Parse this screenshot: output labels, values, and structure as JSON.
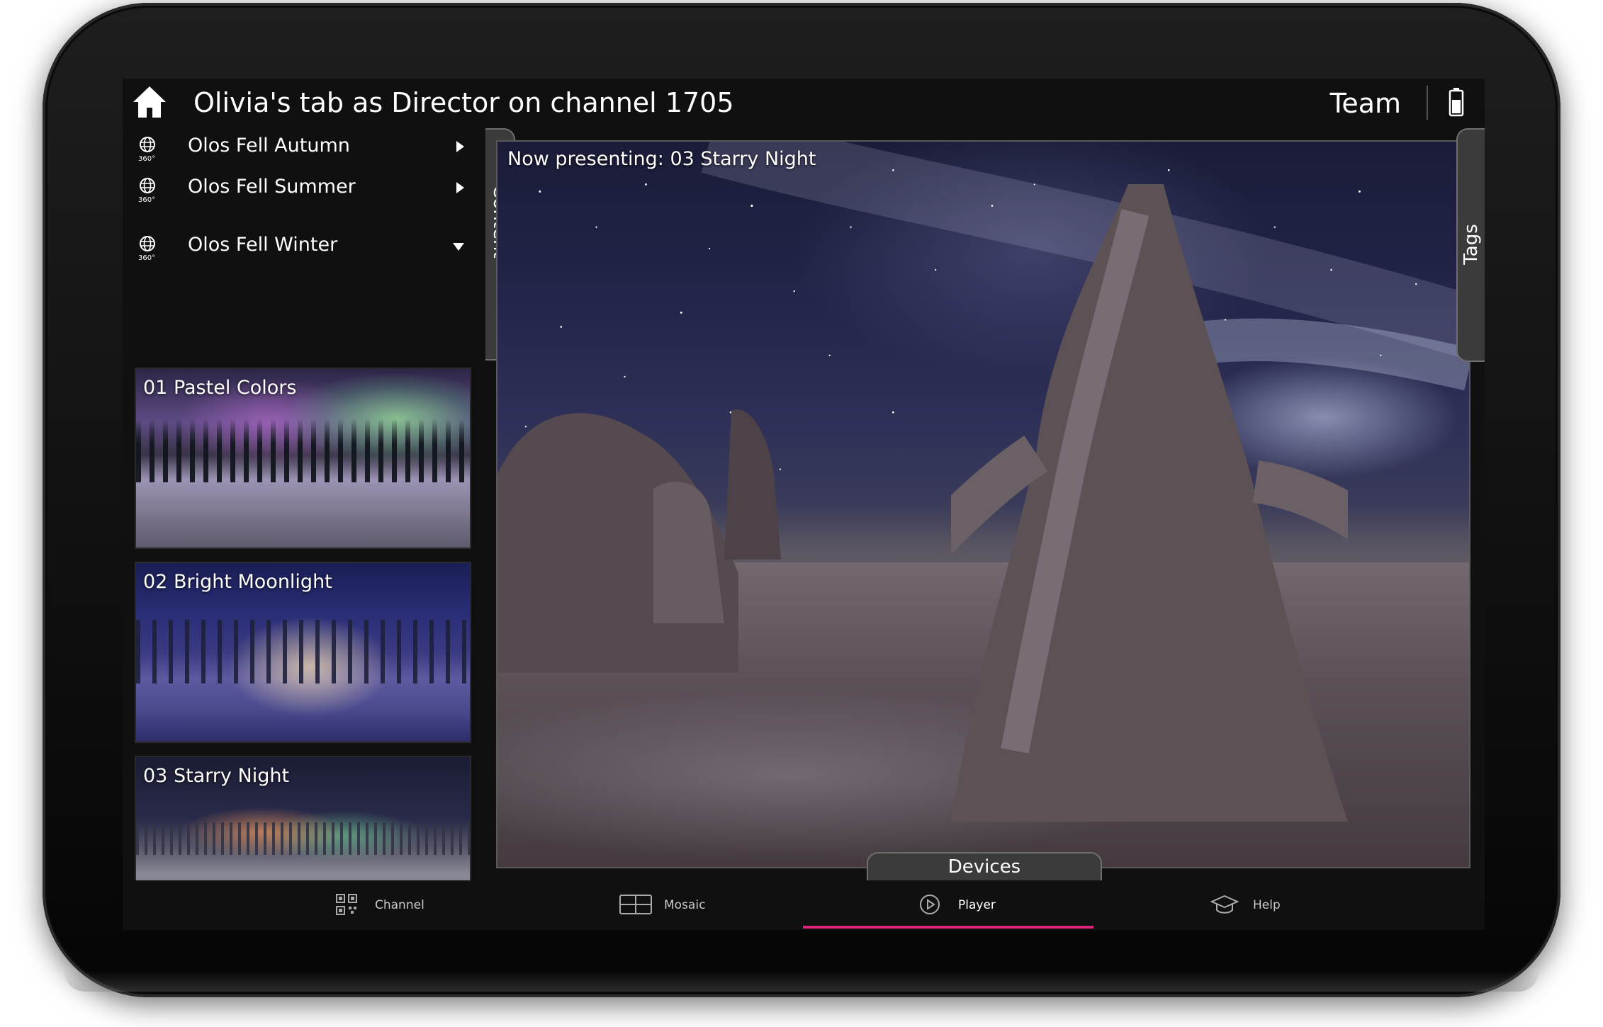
{
  "header": {
    "title": "Olivia's tab as Director on channel 1705",
    "team_label": "Team",
    "home_icon": "home-icon",
    "battery_icon": "battery-icon"
  },
  "categories": [
    {
      "icon": "360-globe-icon",
      "label": "Olos Fell Autumn",
      "expanded": false
    },
    {
      "icon": "360-globe-icon",
      "label": "Olos Fell Summer",
      "expanded": false
    },
    {
      "icon": "360-globe-icon",
      "label": "Olos Fell Winter",
      "expanded": true
    }
  ],
  "category_icon_text": "360°",
  "thumbnails": [
    {
      "label": "01 Pastel Colors"
    },
    {
      "label": "02 Bright Moonlight"
    },
    {
      "label": "03 Starry Night"
    }
  ],
  "side_tabs": {
    "content": "Content",
    "tags": "Tags",
    "devices": "Devices"
  },
  "player": {
    "now_presenting": "Now presenting: 03 Starry Night"
  },
  "bottom_nav": [
    {
      "icon": "qr-code-icon",
      "label": "Channel",
      "active": false
    },
    {
      "icon": "mosaic-grid-icon",
      "label": "Mosaic",
      "active": false
    },
    {
      "icon": "play-circle-icon",
      "label": "Player",
      "active": true
    },
    {
      "icon": "graduation-cap-icon",
      "label": "Help",
      "active": false
    }
  ],
  "colors": {
    "accent": "#e0237a",
    "background": "#101010",
    "tab_fill": "#3b3b3b"
  }
}
